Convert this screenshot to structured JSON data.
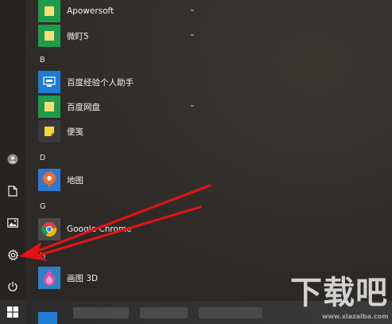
{
  "apps": {
    "apowersoft": {
      "label": "Apowersoft",
      "expand": "⌄"
    },
    "weiding": {
      "label": "微盯5",
      "expand": "⌄"
    },
    "section_b": "B",
    "baidu_helper": {
      "label": "百度经验个人助手"
    },
    "baidu_pan": {
      "label": "百度网盘",
      "expand": "⌄"
    },
    "bianqian": {
      "label": "便笺"
    },
    "section_d": "D",
    "ditu": {
      "label": "地图"
    },
    "section_g": "G",
    "chrome": {
      "label": "Google Chrome"
    },
    "section_h": "H",
    "paint3d": {
      "label": "画图 3D"
    }
  },
  "watermark": {
    "main": "下载吧",
    "url": "www.xiazaiba.com"
  },
  "colors": {
    "arrow_red": "#e01414",
    "tile_green": "#1e9b4b",
    "tile_blue": "#1d7bd3",
    "folder_yellow": "#f3e07a"
  },
  "icons": {
    "rail": [
      "user-icon",
      "document-icon",
      "pictures-icon",
      "settings-gear-icon",
      "power-icon",
      "windows-logo-icon"
    ]
  }
}
